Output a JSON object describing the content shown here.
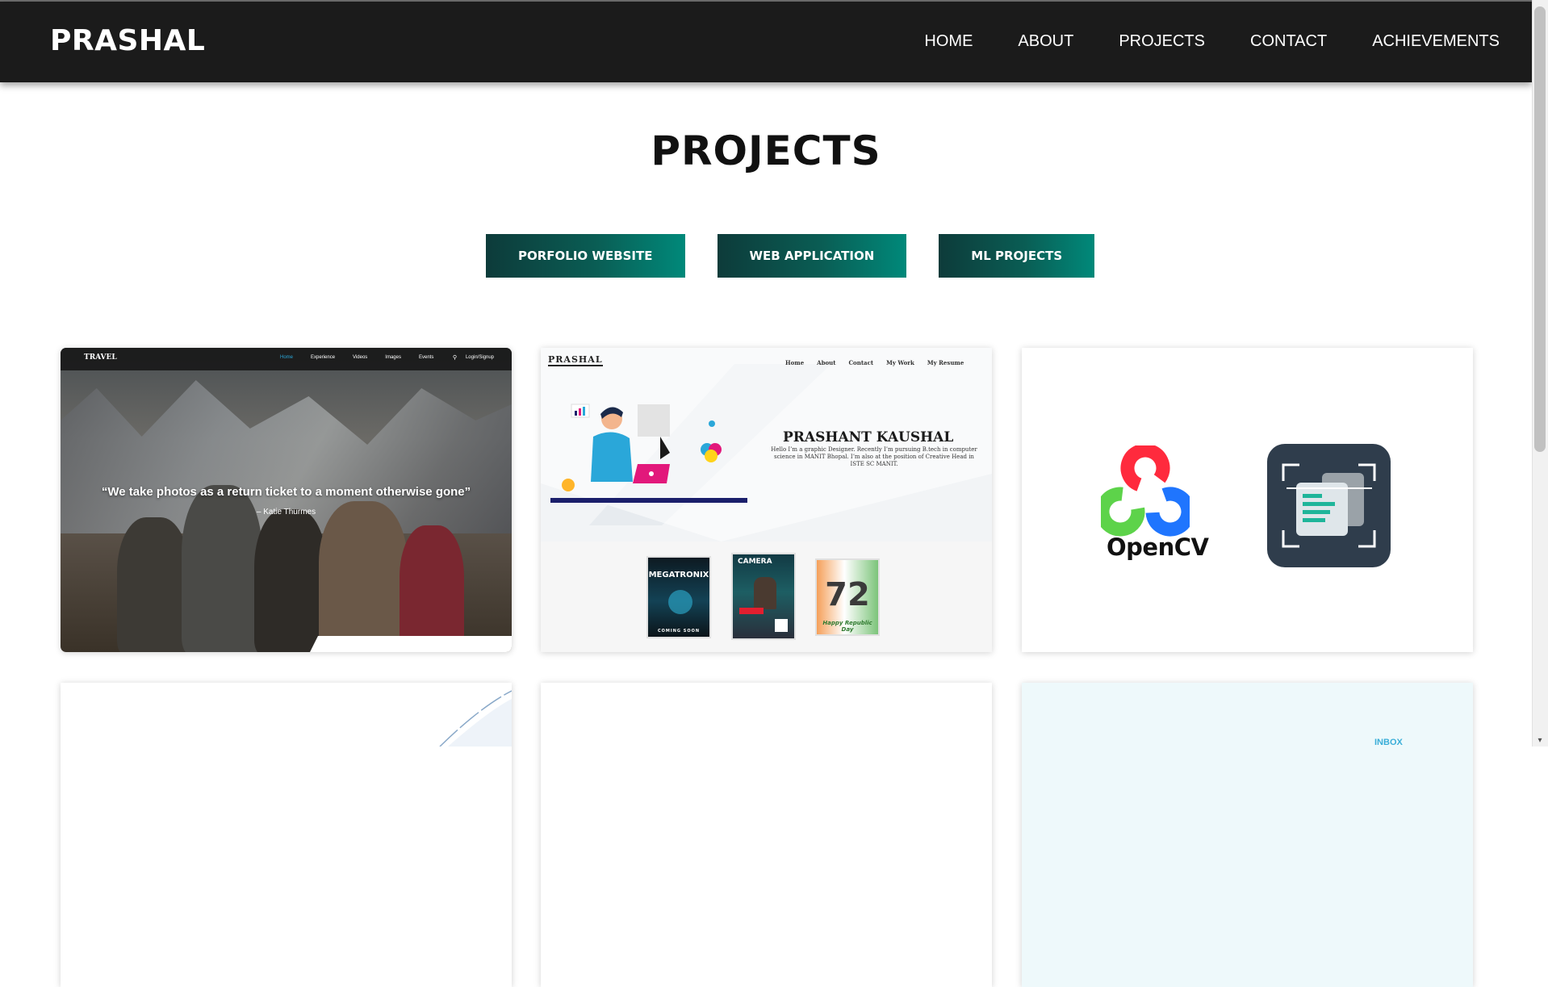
{
  "brand": "PRASHAL",
  "nav": {
    "items": [
      "HOME",
      "ABOUT",
      "PROJECTS",
      "CONTACT",
      "ACHIEVEMENTS"
    ]
  },
  "page_title": "PROJECTS",
  "filters": [
    "PORFOLIO WEBSITE",
    "WEB APPLICATION",
    "ML PROJECTS"
  ],
  "projects": {
    "travel": {
      "logo": "TRAVEL",
      "menu": [
        "Home",
        "Experience",
        "Videos",
        "Images",
        "Events"
      ],
      "login": "Login/Signup",
      "quote": "“We take photos as a return ticket to a moment otherwise gone”",
      "author": "– Katie Thurmes"
    },
    "portfolio": {
      "logo": "PRASHAL",
      "menu": [
        "Home",
        "About",
        "Contact",
        "My Work",
        "My Resume"
      ],
      "name": "PRASHANT KAUSHAL",
      "description": "Hello I’m a graphic Designer. Recently I’m pursuing B.tech in computer science in MANIT Bhopal. I’m also at the position of Creative Head in ISTE SC MANIT.",
      "poster1_text": "MEGATRONIX",
      "poster1_sub": "COMING SOON",
      "poster2_text": "CAMERA",
      "poster3_text": "72",
      "poster3_sub": "Happy Republic Day"
    },
    "ml": {
      "opencv_label": "OpenCV"
    },
    "inbox_label": "INBOX"
  },
  "colors": {
    "navbar": "#1b1b1b",
    "button_gradient_start": "#0d3b3a",
    "button_gradient_end": "#00897a"
  }
}
